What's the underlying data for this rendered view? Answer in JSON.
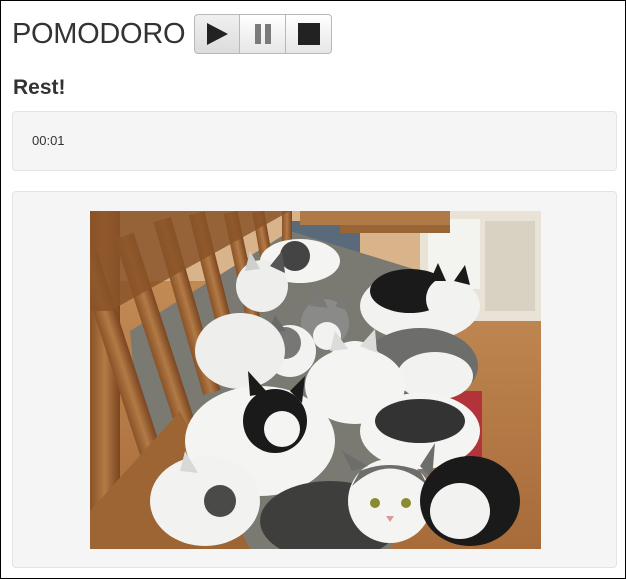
{
  "app": {
    "title": "POMODORO"
  },
  "controls": [
    {
      "name": "play",
      "icon": "play-icon",
      "label": "Play"
    },
    {
      "name": "pause",
      "icon": "pause-icon",
      "label": "Pause"
    },
    {
      "name": "stop",
      "icon": "stop-icon",
      "label": "Stop"
    }
  ],
  "status": {
    "heading": "Rest!"
  },
  "timer": {
    "display": "00:01"
  },
  "photo": {
    "alt": "Cats napping together"
  },
  "colors": {
    "text": "#333333",
    "well_background": "#f5f5f5",
    "well_border": "#e3e3e3"
  }
}
